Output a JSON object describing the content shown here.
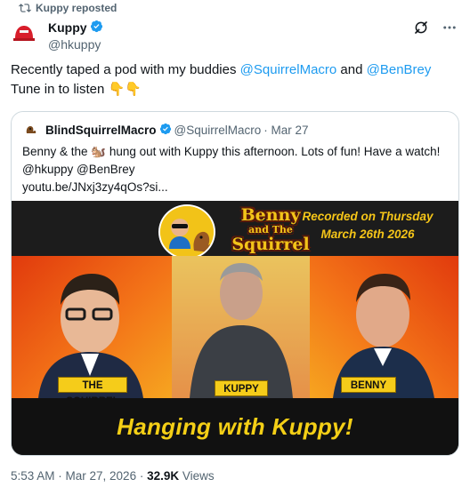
{
  "repost_label": "Kuppy reposted",
  "author": {
    "name": "Kuppy",
    "handle": "@hkuppy"
  },
  "tweet": {
    "line1_pre": "Recently taped a pod with my buddies ",
    "mention1": "@SquirrelMacro",
    "line1_mid": " and ",
    "mention2": "@BenBrey",
    "line2": "Tune in to listen",
    "emoji": "👇👇"
  },
  "quote": {
    "name": "BlindSquirrelMacro",
    "handle": "@SquirrelMacro",
    "date": "· Mar 27",
    "text_line1": "Benny & the 🐿️ hung out with Kuppy this afternoon. Lots of fun! Have a watch!",
    "text_line2": "@hkuppy @BenBrey",
    "text_line3": "youtu.be/JNxj3zy4qOs?si..."
  },
  "thumbnail": {
    "logo_title_line1": "Benny",
    "logo_title_line2": "and The",
    "logo_title_line3": "Squirrel",
    "recorded_line1": "Recorded on Thursday",
    "recorded_line2": "March 26th 2026",
    "tag_left": "THE SQUIRREL",
    "tag_center": "KUPPY",
    "tag_right": "BENNY",
    "headline": "Hanging with Kuppy!"
  },
  "footer": {
    "time": "5:53 AM · Mar 27, 2026 · ",
    "views_count": "32.9K",
    "views_label": " Views"
  },
  "icons": {
    "repost": "repost-icon",
    "verified": "verified-badge-icon",
    "grok": "grok-icon",
    "more": "more-icon"
  },
  "colors": {
    "link": "#1d9bf0",
    "verified": "#1d9bf0",
    "secondary_text": "#536471",
    "thumbnail_yellow": "#f4cf16"
  }
}
